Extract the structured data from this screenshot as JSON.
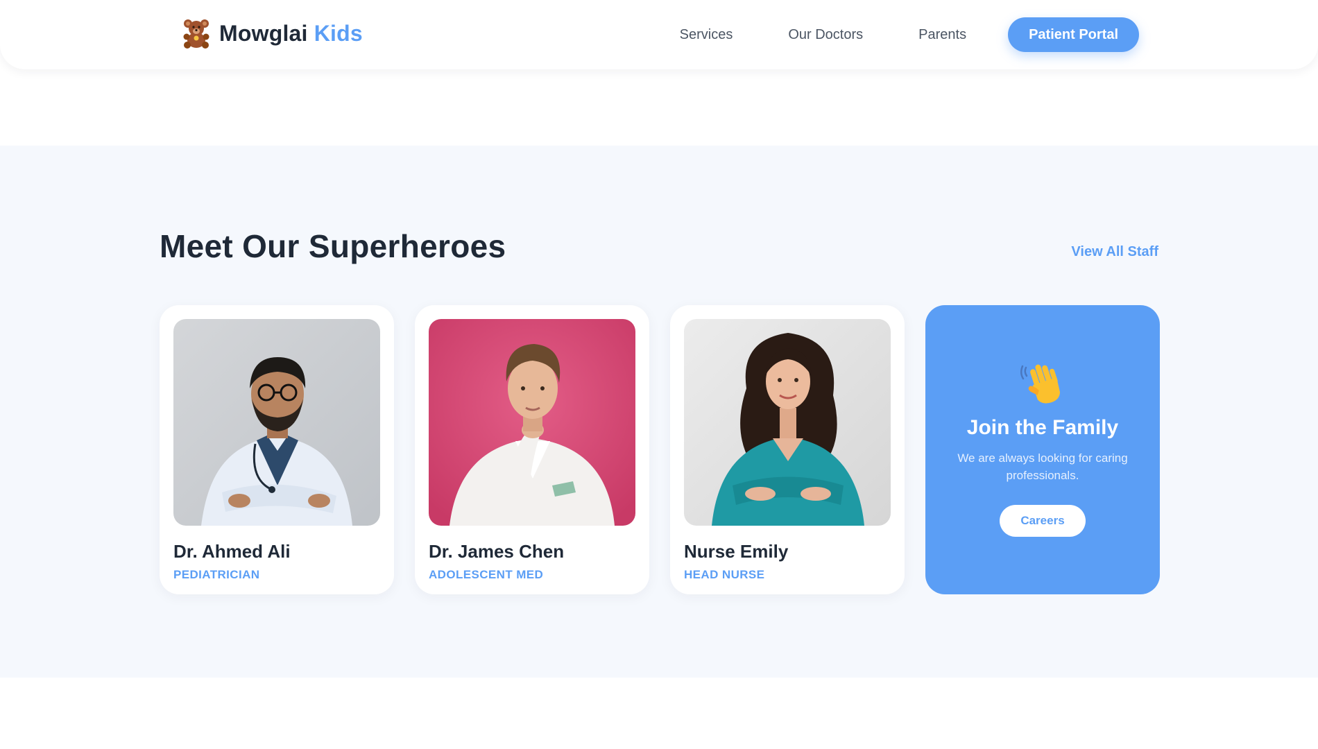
{
  "header": {
    "brand": {
      "name": "Mowglai",
      "accent": "Kids",
      "logo_icon": "teddy-bear-icon"
    },
    "nav": [
      {
        "label": "Services"
      },
      {
        "label": "Our Doctors"
      },
      {
        "label": "Parents"
      }
    ],
    "portal_button": "Patient Portal"
  },
  "team": {
    "title": "Meet Our Superheroes",
    "view_all": "View All Staff",
    "members": [
      {
        "name": "Dr. Ahmed Ali",
        "role": "PEDIATRICIAN"
      },
      {
        "name": "Dr. James Chen",
        "role": "ADOLESCENT MED"
      },
      {
        "name": "Nurse Emily",
        "role": "HEAD NURSE"
      }
    ],
    "join": {
      "icon": "waving-hand-icon",
      "title": "Join the Family",
      "description": "We are always looking for caring professionals.",
      "button": "Careers"
    }
  },
  "colors": {
    "accent": "#5b9ef5",
    "text_dark": "#1f2937",
    "section_bg": "#f5f8fd"
  }
}
